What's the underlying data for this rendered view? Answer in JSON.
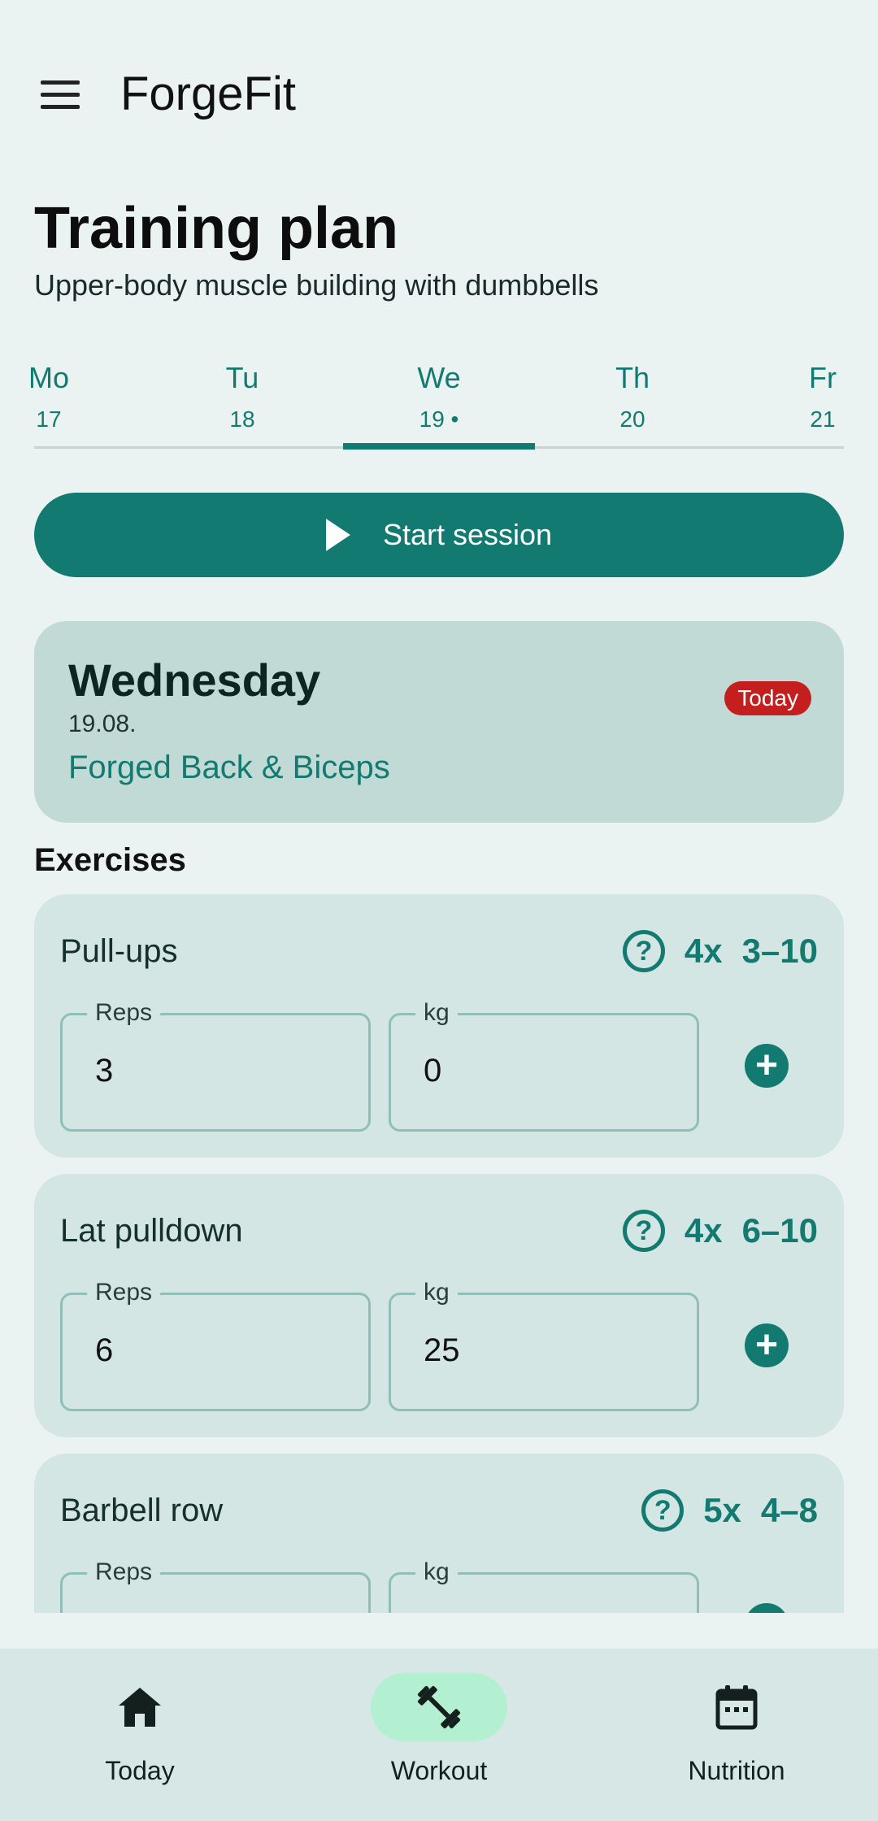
{
  "app": {
    "title": "ForgeFit"
  },
  "header": {
    "title": "Training plan",
    "subtitle": "Upper-body muscle building with dumbbells"
  },
  "days": [
    {
      "name": "Mo",
      "num": "17",
      "active": false
    },
    {
      "name": "Tu",
      "num": "18",
      "active": false
    },
    {
      "name": "We",
      "num": "19 •",
      "active": true
    },
    {
      "name": "Th",
      "num": "20",
      "active": false
    },
    {
      "name": "Fr",
      "num": "21",
      "active": false
    }
  ],
  "start_button": {
    "label": "Start session"
  },
  "day_card": {
    "weekday": "Wednesday",
    "date": "19.08.",
    "workout": "Forged Back & Biceps",
    "badge": "Today"
  },
  "exercises_title": "Exercises",
  "exercises": [
    {
      "name": "Pull-ups",
      "sets": "4x",
      "range": "3–10",
      "reps_label": "Reps",
      "reps": "3",
      "kg_label": "kg",
      "kg": "0"
    },
    {
      "name": "Lat pulldown",
      "sets": "4x",
      "range": "6–10",
      "reps_label": "Reps",
      "reps": "6",
      "kg_label": "kg",
      "kg": "25"
    },
    {
      "name": "Barbell row",
      "sets": "5x",
      "range": "4–8",
      "reps_label": "Reps",
      "reps": "",
      "kg_label": "kg",
      "kg": ""
    }
  ],
  "bottom_nav": [
    {
      "label": "Today",
      "icon": "home-icon",
      "active": false
    },
    {
      "label": "Workout",
      "icon": "dumbbell-icon",
      "active": true
    },
    {
      "label": "Nutrition",
      "icon": "calendar-icon",
      "active": false
    }
  ],
  "colors": {
    "accent": "#127a70",
    "badge": "#c41e1e",
    "nav_active": "#b3f0d2"
  }
}
